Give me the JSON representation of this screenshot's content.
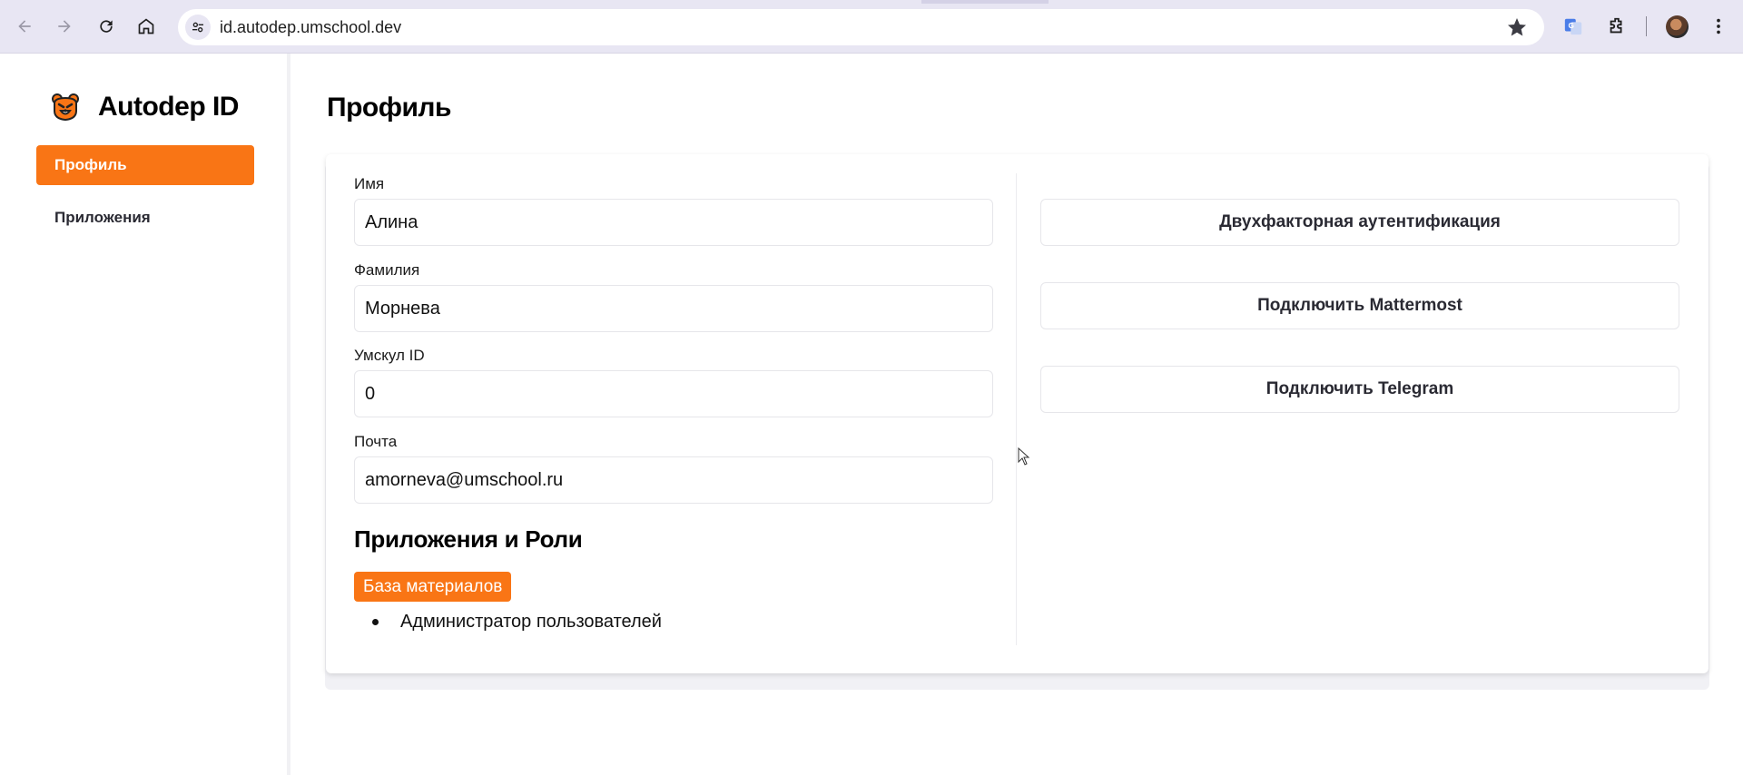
{
  "browser": {
    "url": "id.autodep.umschool.dev",
    "icons": [
      "back-icon",
      "forward-icon",
      "reload-icon",
      "home-icon",
      "site-settings-icon",
      "bookmark-star-icon",
      "translate-extension-icon",
      "extensions-puzzle-icon",
      "profile-avatar",
      "more-menu-icon"
    ]
  },
  "sidebar": {
    "brand": "Autodep ID",
    "items": [
      {
        "label": "Профиль",
        "active": true
      },
      {
        "label": "Приложения",
        "active": false
      }
    ]
  },
  "main": {
    "title": "Профиль",
    "fields": [
      {
        "label": "Имя",
        "value": "Алина"
      },
      {
        "label": "Фамилия",
        "value": "Морнева"
      },
      {
        "label": "Умскул ID",
        "value": "0"
      },
      {
        "label": "Почта",
        "value": "amorneva@umschool.ru"
      }
    ],
    "apps_section": {
      "title": "Приложения и Роли",
      "app_tag": "База материалов",
      "roles": [
        "Администратор пользователей"
      ]
    },
    "actions": [
      "Двухфакторная аутентификация",
      "Подключить Mattermost",
      "Подключить Telegram"
    ]
  },
  "colors": {
    "accent": "#f97515",
    "chrome": "#e8e6f3"
  }
}
